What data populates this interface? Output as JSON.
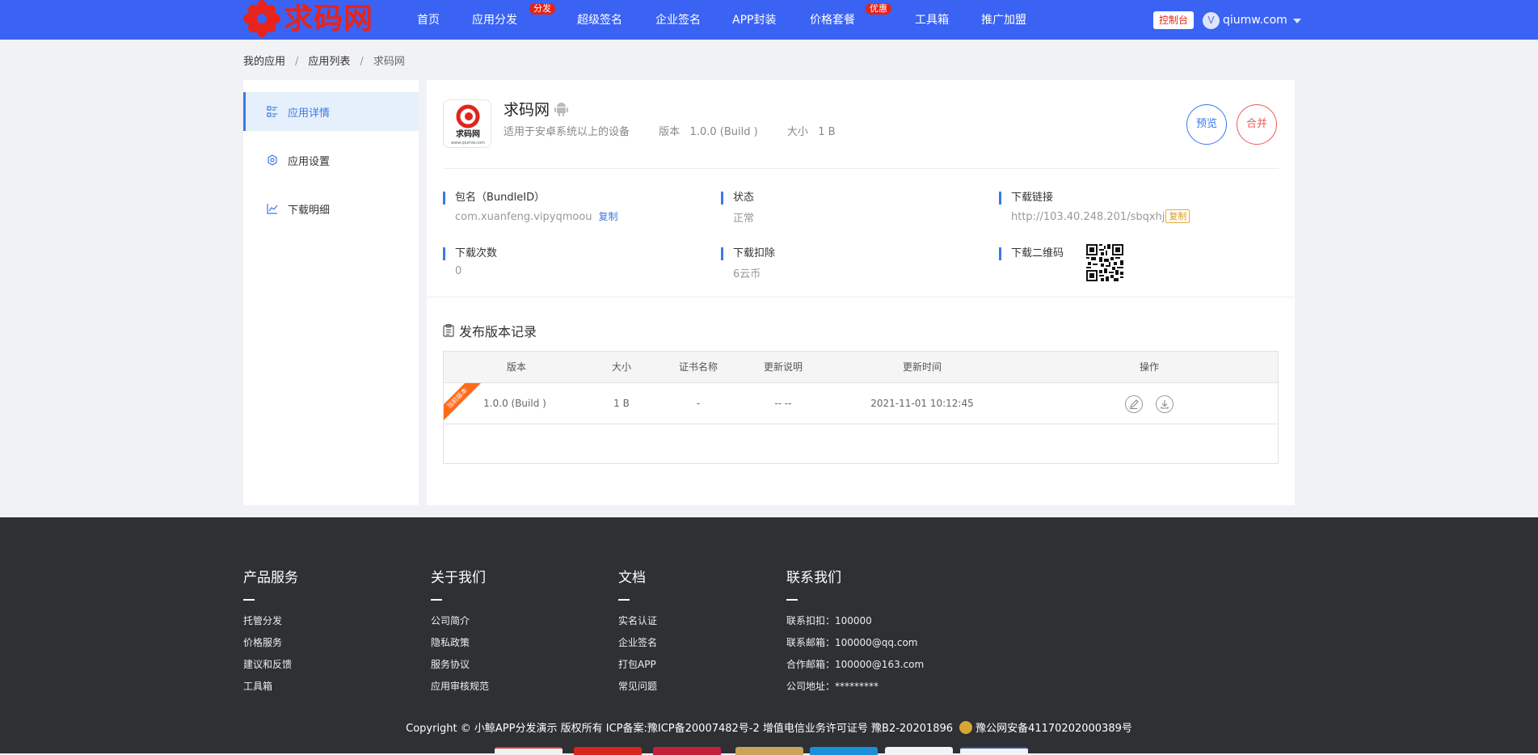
{
  "header": {
    "logo_text": "求码网",
    "nav": [
      {
        "label": "首页"
      },
      {
        "label": "应用分发",
        "badge": "分发"
      },
      {
        "label": "超级签名"
      },
      {
        "label": "企业签名"
      },
      {
        "label": "APP封装"
      },
      {
        "label": "价格套餐",
        "badge": "优惠"
      },
      {
        "label": "工具箱"
      },
      {
        "label": "推广加盟"
      }
    ],
    "console_label": "控制台",
    "user_initial": "V",
    "user_name": "qiumw.com"
  },
  "breadcrumb": [
    "我的应用",
    "应用列表",
    "求码网"
  ],
  "sidebar": {
    "items": [
      {
        "label": "应用详情",
        "icon": "list-icon"
      },
      {
        "label": "应用设置",
        "icon": "gear-icon"
      },
      {
        "label": "下载明细",
        "icon": "chart-icon"
      }
    ]
  },
  "app": {
    "icon_text": "求码网",
    "icon_subtext": "www.qiumw.com",
    "name": "求码网",
    "platform_icon": "android-icon",
    "description": "适用于安卓系统以上的设备",
    "version": "版本   1.0.0 (Build )",
    "size": "大小   1 B",
    "preview_label": "预览",
    "merge_label": "合并"
  },
  "fields": {
    "bundle_label": "包名（BundleID）",
    "bundle_value": "com.xuanfeng.vipyqmoou",
    "bundle_copy": "复制",
    "status_label": "状态",
    "status_value": "正常",
    "link_label": "下载链接",
    "link_value": "http://103.40.248.201/sbqxhj",
    "link_copy": "复制",
    "downloads_label": "下载次数",
    "downloads_value": "0",
    "deduct_label": "下载扣除",
    "deduct_value": "6云币",
    "qrcode_label": "下载二维码"
  },
  "versions": {
    "title": "发布版本记录",
    "columns": [
      "版本",
      "大小",
      "证书名称",
      "更新说明",
      "更新时间",
      "操作"
    ],
    "rows": [
      {
        "ribbon": "当前版本",
        "version": "1.0.0 (Build )",
        "size": "1 B",
        "cert": "-",
        "notes": "-- --",
        "updated": "2021-11-01 10:12:45"
      }
    ]
  },
  "footer": {
    "columns": [
      {
        "title": "产品服务",
        "items": [
          "托管分发",
          "价格服务",
          "建议和反馈",
          "工具箱"
        ]
      },
      {
        "title": "关于我们",
        "items": [
          "公司简介",
          "隐私政策",
          "服务协议",
          "应用审核规范"
        ]
      },
      {
        "title": "文档",
        "items": [
          "实名认证",
          "企业签名",
          "打包APP",
          "常见问题"
        ]
      },
      {
        "title": "联系我们",
        "items": [
          "联系扣扣：100000",
          "联系邮箱：100000@qq.com",
          "合作邮箱：100000@163.com",
          "公司地址：*********"
        ]
      }
    ],
    "copyright": "Copyright © 小鲸APP分发演示 版权所有 ICP备案:豫ICP备20007482号-2 增值电信业务许可证号 豫B2-20201896",
    "police_text": "豫公网安备41170202000389号"
  },
  "colors": {
    "header_bg": "#3a63f4",
    "accent": "#3b79e6",
    "danger": "#e1251b",
    "footer_bg": "#2e3033"
  }
}
